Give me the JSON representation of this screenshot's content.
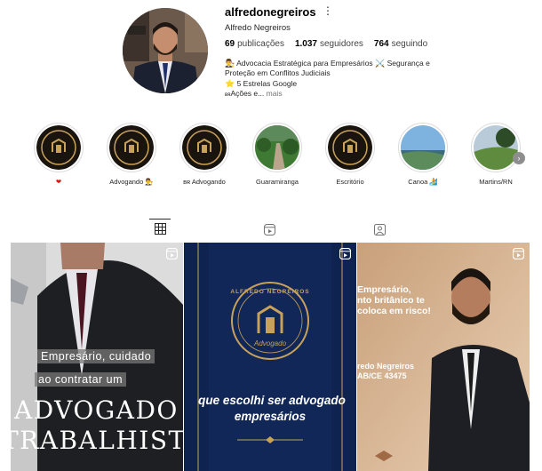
{
  "profile": {
    "username": "alfredonegreiros",
    "full_name": "Alfredo Negreiros",
    "stats": [
      {
        "value": "69",
        "label": "publicações"
      },
      {
        "value": "1.037",
        "label": "seguidores"
      },
      {
        "value": "764",
        "label": "seguindo"
      }
    ],
    "bio": {
      "line1": "Advocacia Estratégica para Empresários",
      "line1b": "Segurança e",
      "line2": "Proteção em Conflitos Judiciais",
      "line3": "5 Estrelas Google",
      "line4_prefix": "ʙʀ",
      "line4": "Ações e...",
      "more": "mais"
    }
  },
  "highlights": [
    {
      "label": "❤",
      "icon": "logo"
    },
    {
      "label": "Advogando",
      "icon": "logo"
    },
    {
      "label": "ʙʀ Advogando",
      "icon": "logo"
    },
    {
      "label": "Guaramiranga",
      "icon": "forest"
    },
    {
      "label": "Escritório",
      "icon": "logo"
    },
    {
      "label": "Canoa",
      "icon": "beach"
    },
    {
      "label": "Martins/RN",
      "icon": "valley"
    }
  ],
  "tabs": [
    {
      "name": "posts",
      "icon": "grid-icon",
      "active": true
    },
    {
      "name": "reels",
      "icon": "reels-icon",
      "active": false
    },
    {
      "name": "tagged",
      "icon": "tagged-icon",
      "active": false
    }
  ],
  "posts": [
    {
      "line1": "Empresário, cuidado",
      "line2": "ao contratar um",
      "line3": "ADVOGADO",
      "line4": "TRABALHISTA"
    },
    {
      "logo_top": "ALFREDO NEGREIROS",
      "logo_bottom": "Advogado",
      "line1": "que escolhi ser advogado",
      "line2": "empresários"
    },
    {
      "line1": "Empresário,",
      "line2": "nto britânico te",
      "line3": "coloca em risco!",
      "name": "redo Negreiros",
      "oab": "AB/CE 43475"
    }
  ],
  "colors": {
    "navy": "#0f2350",
    "gold": "#c9a25a",
    "tan": "#d9b48c"
  }
}
